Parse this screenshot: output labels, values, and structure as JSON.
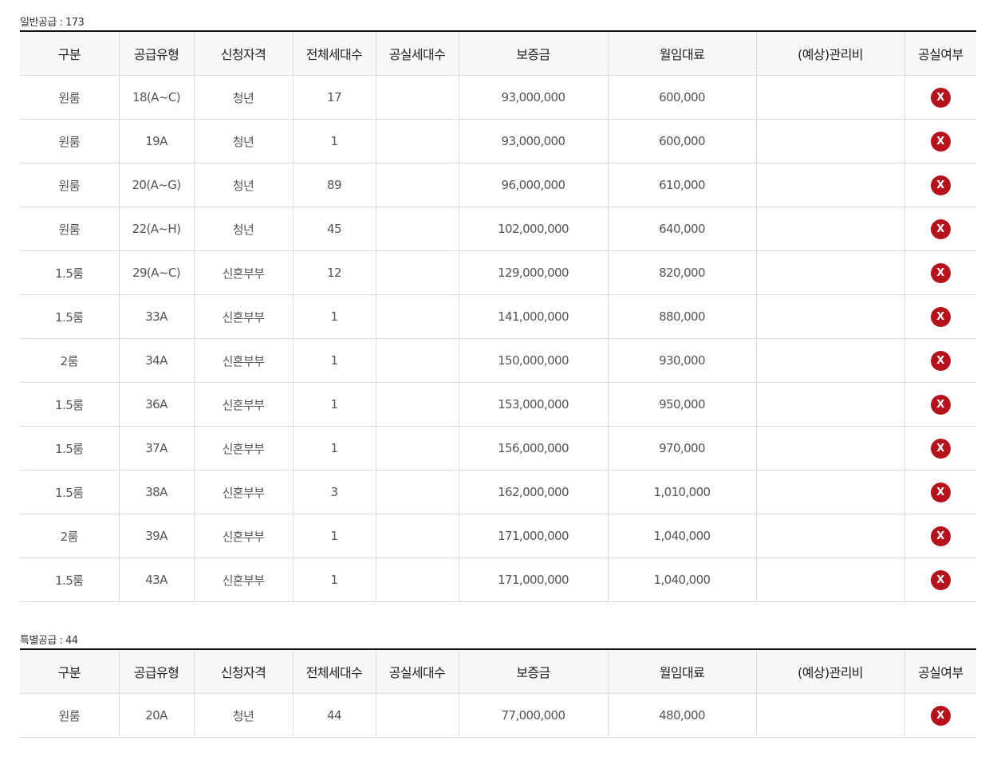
{
  "columns": [
    "구분",
    "공급유형",
    "신청자격",
    "전체세대수",
    "공실세대수",
    "보증금",
    "월임대료",
    "(예상)관리비",
    "공실여부"
  ],
  "vacancy_icon": {
    "name": "x-icon",
    "glyph": "X",
    "color": "#b5121b"
  },
  "general": {
    "caption": "일반공급 : 173",
    "rows": [
      {
        "type": "원룸",
        "supply": "18(A~C)",
        "qual": "청년",
        "total": "17",
        "vacant": "",
        "deposit": "93,000,000",
        "rent": "600,000",
        "fee": ""
      },
      {
        "type": "원룸",
        "supply": "19A",
        "qual": "청년",
        "total": "1",
        "vacant": "",
        "deposit": "93,000,000",
        "rent": "600,000",
        "fee": ""
      },
      {
        "type": "원룸",
        "supply": "20(A~G)",
        "qual": "청년",
        "total": "89",
        "vacant": "",
        "deposit": "96,000,000",
        "rent": "610,000",
        "fee": ""
      },
      {
        "type": "원룸",
        "supply": "22(A~H)",
        "qual": "청년",
        "total": "45",
        "vacant": "",
        "deposit": "102,000,000",
        "rent": "640,000",
        "fee": ""
      },
      {
        "type": "1.5룸",
        "supply": "29(A~C)",
        "qual": "신혼부부",
        "total": "12",
        "vacant": "",
        "deposit": "129,000,000",
        "rent": "820,000",
        "fee": ""
      },
      {
        "type": "1.5룸",
        "supply": "33A",
        "qual": "신혼부부",
        "total": "1",
        "vacant": "",
        "deposit": "141,000,000",
        "rent": "880,000",
        "fee": ""
      },
      {
        "type": "2룸",
        "supply": "34A",
        "qual": "신혼부부",
        "total": "1",
        "vacant": "",
        "deposit": "150,000,000",
        "rent": "930,000",
        "fee": ""
      },
      {
        "type": "1.5룸",
        "supply": "36A",
        "qual": "신혼부부",
        "total": "1",
        "vacant": "",
        "deposit": "153,000,000",
        "rent": "950,000",
        "fee": ""
      },
      {
        "type": "1.5룸",
        "supply": "37A",
        "qual": "신혼부부",
        "total": "1",
        "vacant": "",
        "deposit": "156,000,000",
        "rent": "970,000",
        "fee": ""
      },
      {
        "type": "1.5룸",
        "supply": "38A",
        "qual": "신혼부부",
        "total": "3",
        "vacant": "",
        "deposit": "162,000,000",
        "rent": "1,010,000",
        "fee": ""
      },
      {
        "type": "2룸",
        "supply": "39A",
        "qual": "신혼부부",
        "total": "1",
        "vacant": "",
        "deposit": "171,000,000",
        "rent": "1,040,000",
        "fee": ""
      },
      {
        "type": "1.5룸",
        "supply": "43A",
        "qual": "신혼부부",
        "total": "1",
        "vacant": "",
        "deposit": "171,000,000",
        "rent": "1,040,000",
        "fee": ""
      }
    ]
  },
  "special": {
    "caption": "특별공급 : 44",
    "rows": [
      {
        "type": "원룸",
        "supply": "20A",
        "qual": "청년",
        "total": "44",
        "vacant": "",
        "deposit": "77,000,000",
        "rent": "480,000",
        "fee": ""
      }
    ]
  }
}
